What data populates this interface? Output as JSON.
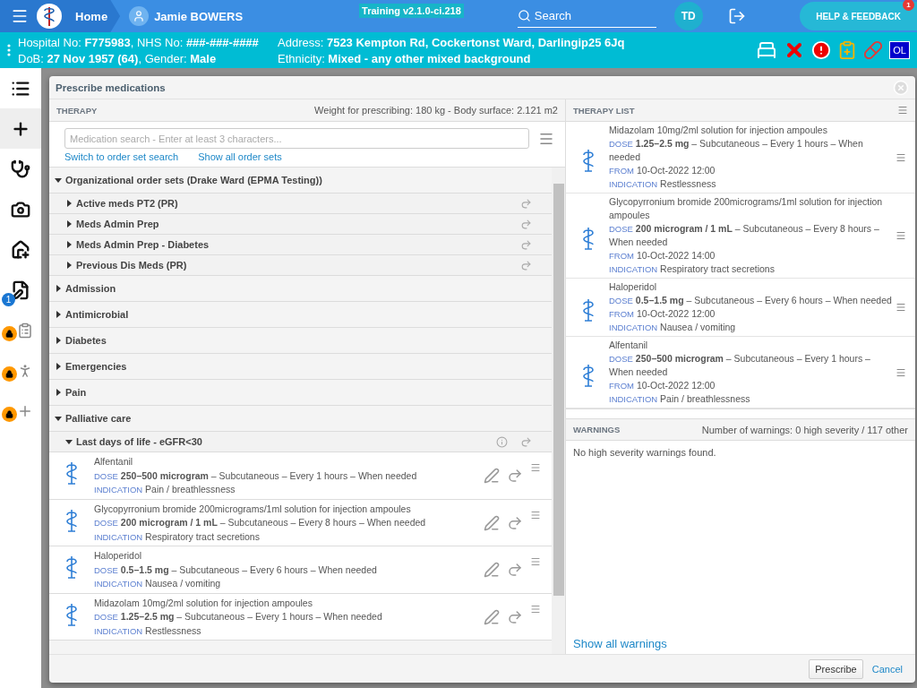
{
  "topbar": {
    "home": "Home",
    "patient_name": "Jamie BOWERS",
    "version": "Training v2.1.0-ci.218",
    "search_placeholder": "Search",
    "user_initials": "TD",
    "help_label": "HELP & FEEDBACK",
    "help_badge": "1"
  },
  "banner": {
    "lines": [
      {
        "left": "Hospital No: **F775983**, NHS No: **###-###-####**",
        "right": "Address: **7523 Kempton Rd, Cockertonst Ward, Darlingip25 6Jq**"
      },
      {
        "left": "DoB: **27 Nov 1957 (64)**, Gender: **Male**",
        "right": "Ethnicity: **Mixed - any other mixed background**"
      }
    ],
    "badge_text": "OL"
  },
  "sidebar": {
    "items": [
      {
        "selected": false
      },
      {
        "selected": true
      },
      {
        "selected": false
      },
      {
        "selected": false
      },
      {
        "selected": false
      },
      {
        "selected": false,
        "badge": "1"
      },
      {
        "selected": false,
        "locked": true
      },
      {
        "selected": false,
        "locked": true
      },
      {
        "selected": false,
        "locked": true
      }
    ]
  },
  "dialog": {
    "title": "Prescribe medications",
    "therapy": {
      "heading": "THERAPY",
      "weight_info": "Weight for prescribing: 180 kg - Body surface: 2.121 m2",
      "search_placeholder": "Medication search - Enter at least 3 characters...",
      "links": [
        "Switch to order set search",
        "Show all order sets"
      ],
      "tree": [
        {
          "kind": "folder",
          "label": "Organizational order sets (Drake Ward (EPMA Testing))",
          "expanded": true,
          "children": [
            {
              "kind": "orderset",
              "label": "Active meds PT2 (PR)",
              "expanded": false
            },
            {
              "kind": "orderset",
              "label": "Meds Admin Prep",
              "expanded": false
            },
            {
              "kind": "orderset",
              "label": "Meds Admin Prep - Diabetes",
              "expanded": false
            },
            {
              "kind": "orderset",
              "label": "Previous Dis Meds (PR)",
              "expanded": false
            }
          ]
        },
        {
          "kind": "folder",
          "label": "Admission",
          "expanded": false
        },
        {
          "kind": "folder",
          "label": "Antimicrobial",
          "expanded": false
        },
        {
          "kind": "folder",
          "label": "Diabetes",
          "expanded": false
        },
        {
          "kind": "folder",
          "label": "Emergencies",
          "expanded": false
        },
        {
          "kind": "folder",
          "label": "Pain",
          "expanded": false
        },
        {
          "kind": "folder",
          "label": "Palliative care",
          "expanded": true,
          "children": [
            {
              "kind": "orderset",
              "label": "Last days of life - eGFR<30",
              "expanded": true,
              "info": true,
              "meds": [
                {
                  "name": "Alfentanil",
                  "dose_label": "DOSE",
                  "dose": "**250–500 microgram** – Subcutaneous – Every 1 hours – When needed",
                  "indication_label": "INDICATION",
                  "indication": "Pain / breathlessness"
                },
                {
                  "name": "Glycopyrronium bromide 200micrograms/1ml solution for injection ampoules",
                  "dose_label": "DOSE",
                  "dose": "**200 microgram / 1 mL** – Subcutaneous – Every 8 hours – When needed",
                  "indication_label": "INDICATION",
                  "indication": "Respiratory tract secretions"
                },
                {
                  "name": "Haloperidol",
                  "dose_label": "DOSE",
                  "dose": "**0.5–1.5 mg** – Subcutaneous – Every 6 hours – When needed",
                  "indication_label": "INDICATION",
                  "indication": "Nausea / vomiting"
                },
                {
                  "name": "Midazolam 10mg/2ml solution for injection ampoules",
                  "dose_label": "DOSE",
                  "dose": "**1.25–2.5 mg** – Subcutaneous – Every 1 hours – When needed",
                  "indication_label": "INDICATION",
                  "indication": "Restlessness"
                }
              ]
            }
          ]
        }
      ]
    },
    "therapy_list": {
      "heading": "THERAPY LIST",
      "items": [
        {
          "name": "Midazolam 10mg/2ml solution for injection ampoules",
          "dose_label": "DOSE",
          "dose": "**1.25–2.5 mg** – Subcutaneous – Every 1 hours – When needed",
          "from_label": "FROM",
          "from": "10-Oct-2022 12:00",
          "indication_label": "INDICATION",
          "indication": "Restlessness"
        },
        {
          "name": "Glycopyrronium bromide 200micrograms/1ml solution for injection ampoules",
          "dose_label": "DOSE",
          "dose": "**200 microgram / 1 mL** – Subcutaneous – Every 8 hours – When needed",
          "from_label": "FROM",
          "from": "10-Oct-2022 14:00",
          "indication_label": "INDICATION",
          "indication": "Respiratory tract secretions"
        },
        {
          "name": "Haloperidol",
          "dose_label": "DOSE",
          "dose": "**0.5–1.5 mg** – Subcutaneous – Every 6 hours – When needed",
          "from_label": "FROM",
          "from": "10-Oct-2022 12:00",
          "indication_label": "INDICATION",
          "indication": "Nausea / vomiting"
        },
        {
          "name": "Alfentanil",
          "dose_label": "DOSE",
          "dose": "**250–500 microgram** – Subcutaneous – Every 1 hours – When needed",
          "from_label": "FROM",
          "from": "10-Oct-2022 12:00",
          "indication_label": "INDICATION",
          "indication": "Pain / breathlessness"
        }
      ]
    },
    "warnings": {
      "heading": "WARNINGS",
      "summary": "Number of warnings: 0 high severity / 117 other",
      "message": "No high severity warnings found.",
      "link": "Show all warnings"
    },
    "buttons": {
      "primary": "Prescribe",
      "secondary": "Cancel"
    }
  }
}
